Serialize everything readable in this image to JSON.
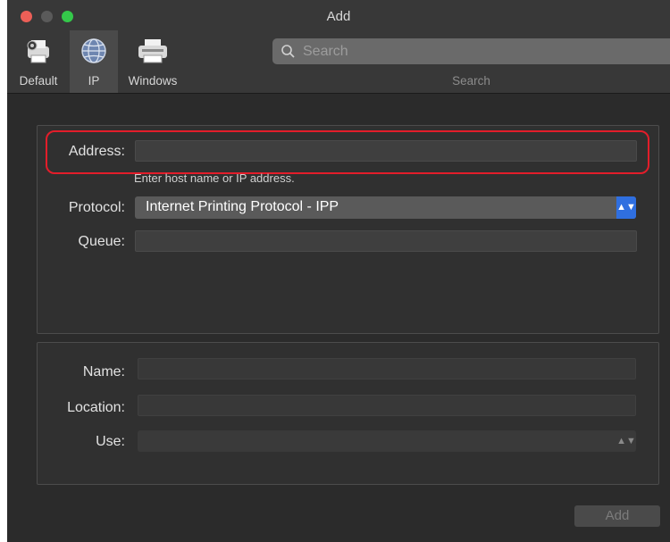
{
  "window": {
    "title": "Add"
  },
  "toolbar": {
    "items": [
      {
        "label": "Default",
        "icon": "printer-default-icon"
      },
      {
        "label": "IP",
        "icon": "globe-icon",
        "selected": true
      },
      {
        "label": "Windows",
        "icon": "printer-windows-icon"
      }
    ],
    "search": {
      "placeholder": "Search",
      "caption": "Search",
      "value": ""
    }
  },
  "form": {
    "address": {
      "label": "Address:",
      "value": "",
      "hint": "Enter host name or IP address."
    },
    "protocol": {
      "label": "Protocol:",
      "value": "Internet Printing Protocol - IPP"
    },
    "queue": {
      "label": "Queue:",
      "value": ""
    },
    "name": {
      "label": "Name:",
      "value": ""
    },
    "location": {
      "label": "Location:",
      "value": ""
    },
    "use": {
      "label": "Use:",
      "value": ""
    }
  },
  "buttons": {
    "add": "Add"
  },
  "colors": {
    "highlight": "#e31d2a",
    "accent": "#2f6fe0",
    "window_bg": "#2b2b2b"
  }
}
